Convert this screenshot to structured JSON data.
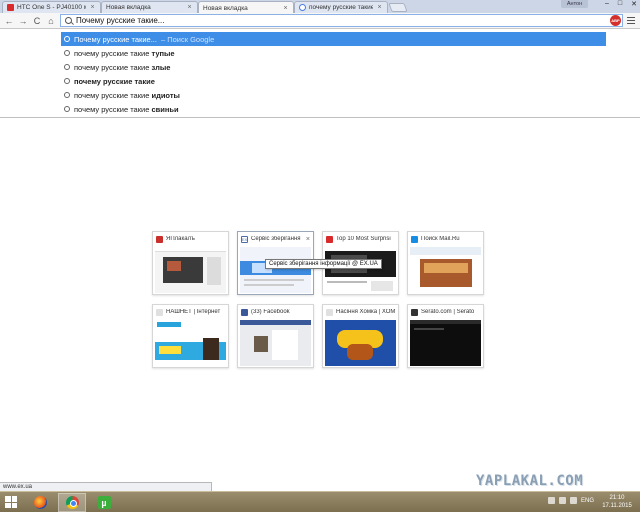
{
  "browser": {
    "tabs": [
      {
        "title": "HTC One S - PJ40100 мо",
        "favicon": "youtube-icon"
      },
      {
        "title": "Новая вкладка",
        "favicon": "none"
      },
      {
        "title": "Новая вкладка",
        "favicon": "none",
        "active": true
      },
      {
        "title": "почему русские такие т",
        "favicon": "google-icon"
      }
    ],
    "profile_name": "Антон",
    "window_buttons": {
      "minimize": "–",
      "maximize": "□",
      "close": "✕"
    }
  },
  "toolbar": {
    "back": "←",
    "forward": "→",
    "reload": "C",
    "home": "⌂",
    "omnibox_value": "Почему русские такие...",
    "extension_label": "ABP"
  },
  "suggestions": [
    {
      "prefix": "Почему русские такие...",
      "bold": "",
      "hint": " – Поиск Google",
      "selected": true
    },
    {
      "prefix": "почему русские такие ",
      "bold": "тупые"
    },
    {
      "prefix": "почему русские такие ",
      "bold": "злые"
    },
    {
      "prefix": "почему русские такие",
      "bold": ""
    },
    {
      "prefix": "почему русские такие ",
      "bold": "идиоты"
    },
    {
      "prefix": "почему русские такие ",
      "bold": "свиньи"
    }
  ],
  "tiles": [
    {
      "title": "ЯПлакалъ",
      "favicon_color": "#c9302c"
    },
    {
      "title": "Сервіс зберігання",
      "favicon_color": "#4b6ea9",
      "favicon_text": "EX"
    },
    {
      "title": "Top 10 Most Surprisi",
      "favicon_color": "#d92b2b"
    },
    {
      "title": "Поиск Mail.Ru",
      "favicon_color": "#168de2"
    },
    {
      "title": "НАШНЕТ | Інтернет",
      "favicon_color": "#e0e0e0"
    },
    {
      "title": "(33) Facebook",
      "favicon_color": "#3b5998"
    },
    {
      "title": "Насіння Хомка | ХОМ",
      "favicon_color": "#e0e0e0"
    },
    {
      "title": "Serato.com | Serato",
      "favicon_color": "#333333"
    }
  ],
  "tooltip": "Сервіс зберігання інформації @ EX.UA",
  "status_url": "www.ex.ua",
  "watermark": "YAPLAKAL.COM",
  "taskbar": {
    "lang": "ENG",
    "time": "21:10",
    "date": "17.11.2015"
  }
}
